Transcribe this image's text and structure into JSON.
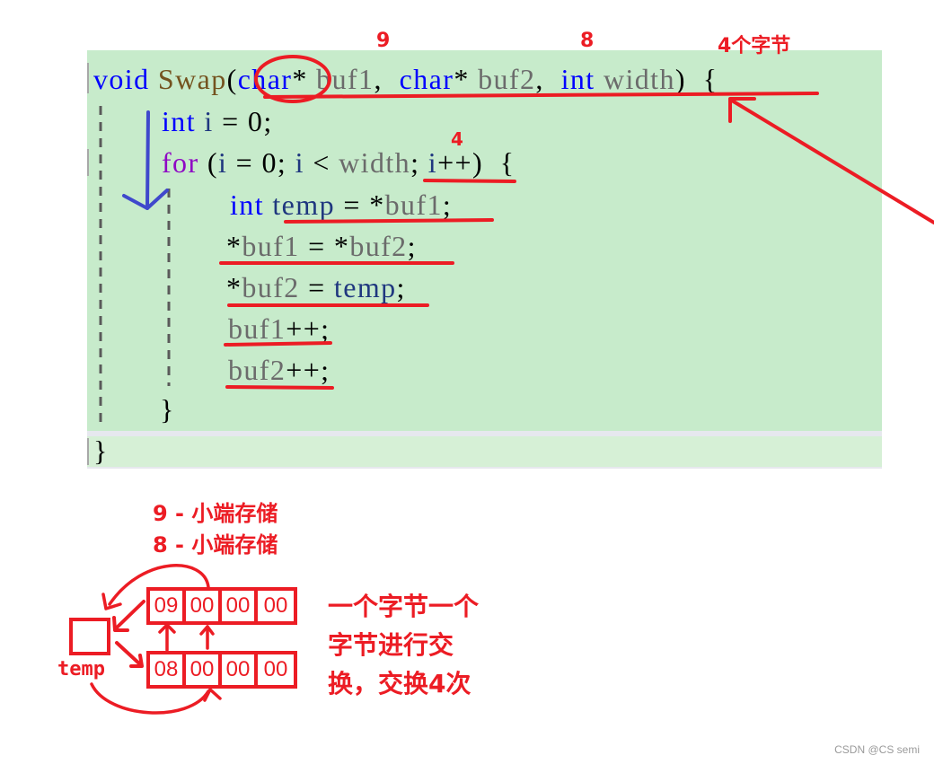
{
  "code": {
    "lines": [
      [
        {
          "t": "void",
          "c": "kw"
        },
        {
          "t": " ",
          "c": "punct"
        },
        {
          "t": "Swap",
          "c": "fn"
        },
        {
          "t": "(",
          "c": "punct"
        },
        {
          "t": "char",
          "c": "kw"
        },
        {
          "t": "* ",
          "c": "punct"
        },
        {
          "t": "buf1",
          "c": "param"
        },
        {
          "t": ",  ",
          "c": "punct"
        },
        {
          "t": "char",
          "c": "kw"
        },
        {
          "t": "* ",
          "c": "punct"
        },
        {
          "t": "buf2",
          "c": "param"
        },
        {
          "t": ",  ",
          "c": "punct"
        },
        {
          "t": "int",
          "c": "kw"
        },
        {
          "t": " ",
          "c": "punct"
        },
        {
          "t": "width",
          "c": "param"
        },
        {
          "t": ")  {",
          "c": "punct"
        }
      ],
      [
        {
          "t": "int",
          "c": "kw"
        },
        {
          "t": " ",
          "c": "punct"
        },
        {
          "t": "i",
          "c": "local"
        },
        {
          "t": " = 0;",
          "c": "punct"
        }
      ],
      [
        {
          "t": "for",
          "c": "kw-ctrl"
        },
        {
          "t": " (",
          "c": "punct"
        },
        {
          "t": "i",
          "c": "local"
        },
        {
          "t": " = 0; ",
          "c": "punct"
        },
        {
          "t": "i",
          "c": "local"
        },
        {
          "t": " < ",
          "c": "punct"
        },
        {
          "t": "width",
          "c": "param"
        },
        {
          "t": "; ",
          "c": "punct"
        },
        {
          "t": "i",
          "c": "local"
        },
        {
          "t": "++)  {",
          "c": "punct"
        }
      ],
      [
        {
          "t": "int",
          "c": "kw"
        },
        {
          "t": " ",
          "c": "punct"
        },
        {
          "t": "temp",
          "c": "local"
        },
        {
          "t": " = *",
          "c": "punct"
        },
        {
          "t": "buf1",
          "c": "param"
        },
        {
          "t": ";",
          "c": "punct"
        }
      ],
      [
        {
          "t": "*",
          "c": "punct"
        },
        {
          "t": "buf1",
          "c": "param"
        },
        {
          "t": " = *",
          "c": "punct"
        },
        {
          "t": "buf2",
          "c": "param"
        },
        {
          "t": ";",
          "c": "punct"
        }
      ],
      [
        {
          "t": "*",
          "c": "punct"
        },
        {
          "t": "buf2",
          "c": "param"
        },
        {
          "t": " = ",
          "c": "punct"
        },
        {
          "t": "temp",
          "c": "local"
        },
        {
          "t": ";",
          "c": "punct"
        }
      ],
      [
        {
          "t": "buf1",
          "c": "param"
        },
        {
          "t": "++;",
          "c": "punct"
        }
      ],
      [
        {
          "t": "buf2",
          "c": "param"
        },
        {
          "t": "++;",
          "c": "punct"
        }
      ],
      [
        {
          "t": "}",
          "c": "punct"
        }
      ],
      [
        {
          "t": "}",
          "c": "punct"
        }
      ]
    ]
  },
  "annotations": {
    "buf1_value": "9",
    "buf2_value": "8",
    "width_bytes": "4个字节",
    "width_value": "4",
    "storage_line1": "9 - 小端存储",
    "storage_line2": "8 - 小端存储",
    "explain_line1": "一个字节一个",
    "explain_line2": "字节进行交",
    "explain_line3": "换，交换4次",
    "temp_label": "temp"
  },
  "memory": {
    "buf1_bytes": [
      "09",
      "00",
      "00",
      "00"
    ],
    "buf2_bytes": [
      "08",
      "00",
      "00",
      "00"
    ]
  },
  "colors": {
    "annotation_red": "#ec1c24",
    "arrow_blue": "#3f48cc",
    "code_background": "#c7ebcb"
  },
  "watermark": "CSDN @CS semi"
}
